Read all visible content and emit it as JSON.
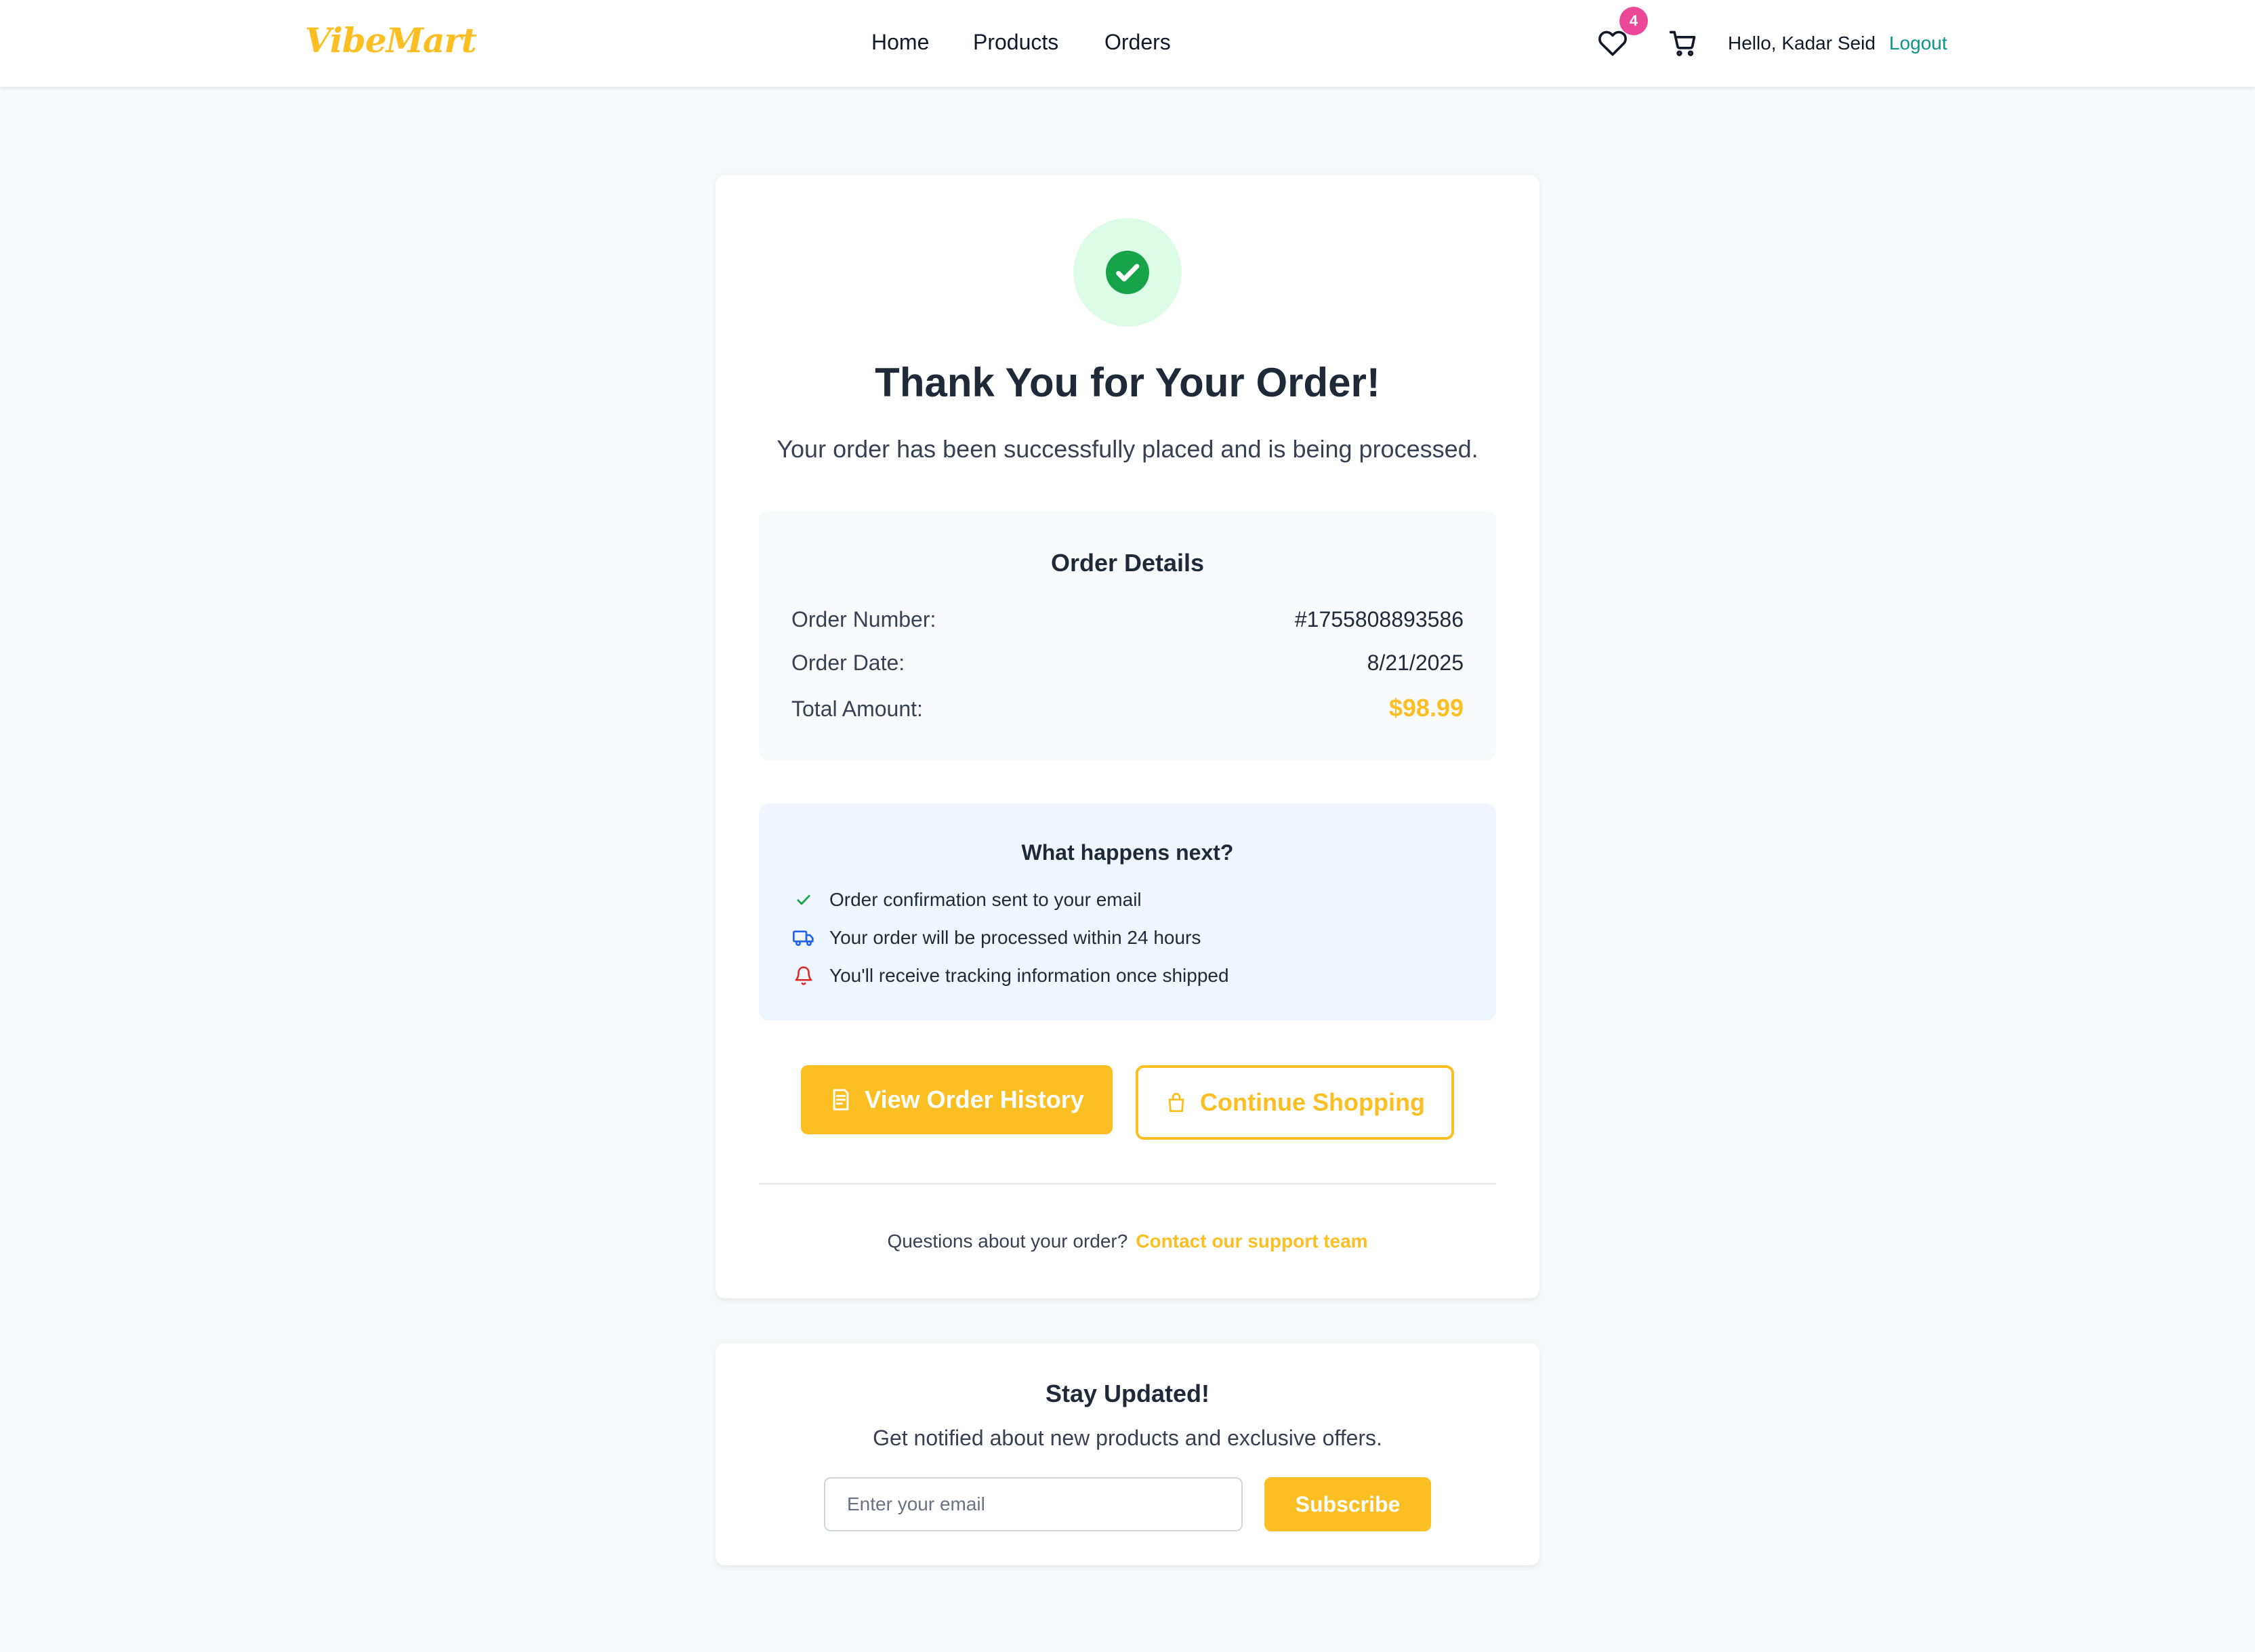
{
  "brand": {
    "name": "VibeMart",
    "accent_color": "#fbbf24"
  },
  "nav": {
    "links": [
      {
        "label": "Home"
      },
      {
        "label": "Products"
      },
      {
        "label": "Orders"
      }
    ],
    "wishlist_icon": "heart-icon",
    "wishlist_count": "4",
    "cart_icon": "cart-icon",
    "greeting": "Hello, Kadar Seid",
    "logout": "Logout"
  },
  "confirmation": {
    "status_icon": "check-circle-icon",
    "title": "Thank You for Your Order!",
    "subtitle": "Your order has been successfully placed and is being processed."
  },
  "order_details": {
    "title": "Order Details",
    "rows": [
      {
        "label": "Order Number:",
        "value": "#1755808893586"
      },
      {
        "label": "Order Date:",
        "value": "8/21/2025"
      },
      {
        "label": "Total Amount:",
        "value": "$98.99"
      }
    ]
  },
  "next_steps": {
    "title": "What happens next?",
    "items": [
      {
        "icon": "check-icon",
        "color": "#16a34a",
        "text": "Order confirmation sent to your email"
      },
      {
        "icon": "truck-icon",
        "color": "#2563eb",
        "text": "Your order will be processed within 24 hours"
      },
      {
        "icon": "bell-icon",
        "color": "#dc2626",
        "text": "You'll receive tracking information once shipped"
      }
    ]
  },
  "actions": {
    "view_history": {
      "label": "View Order History",
      "icon": "receipt-icon"
    },
    "continue_shopping": {
      "label": "Continue Shopping",
      "icon": "shopping-bag-icon"
    }
  },
  "support": {
    "text": "Questions about your order?",
    "link": "Contact our support team"
  },
  "newsletter": {
    "title": "Stay Updated!",
    "subtitle": "Get notified about new products and exclusive offers.",
    "email_placeholder": "Enter your email",
    "email_value": "",
    "button": "Subscribe"
  }
}
